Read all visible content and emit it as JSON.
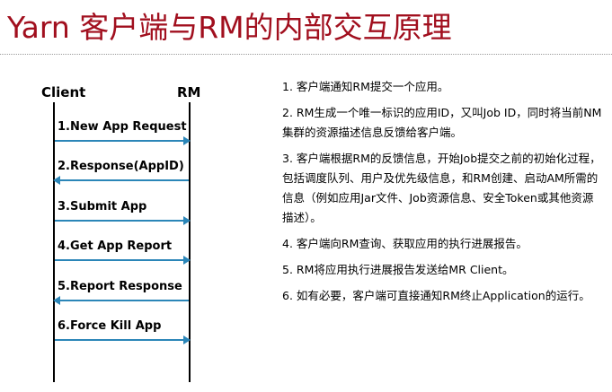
{
  "title": "Yarn 客户端与RM的内部交互原理",
  "diagram": {
    "participants": {
      "client": "Client",
      "rm": "RM"
    },
    "messages": [
      {
        "label": "1.New App Request",
        "direction": "right"
      },
      {
        "label": "2.Response(AppID)",
        "direction": "left"
      },
      {
        "label": "3.Submit App",
        "direction": "right"
      },
      {
        "label": "4.Get App Report",
        "direction": "right"
      },
      {
        "label": "5.Report Response",
        "direction": "left"
      },
      {
        "label": "6.Force Kill App",
        "direction": "right"
      }
    ]
  },
  "steps": [
    "1. 客户端通知RM提交一个应用。",
    "2. RM生成一个唯一标识的应用ID，又叫Job ID，同时将当前NM集群的资源描述信息反馈给客户端。",
    "3. 客户端根据RM的反馈信息，开始Job提交之前的初始化过程，包括调度队列、用户及优先级信息，和RM创建、启动AM所需的信息（例如应用Jar文件、Job资源信息、安全Token或其他资源描述）。",
    "4. 客户端向RM查询、获取应用的执行进展报告。",
    "5. RM将应用执行进展报告发送给MR Client。",
    "6. 如有必要，客户端可直接通知RM终止Application的运行。"
  ],
  "colors": {
    "title": "#a10f1e",
    "arrow": "#2b86b8",
    "text": "#000000"
  }
}
